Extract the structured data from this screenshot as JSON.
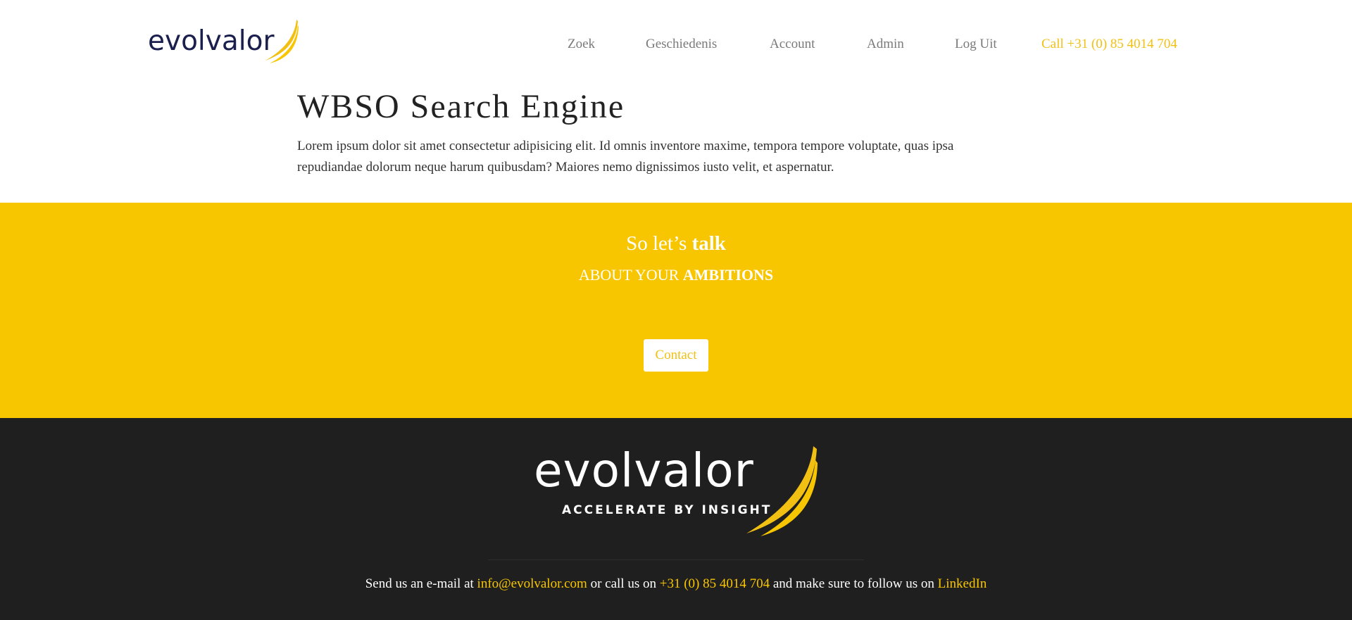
{
  "brand": {
    "logo_text": "evolvalor",
    "tagline": "ACCELERATE BY INSIGHT",
    "accent_color": "#f8c600",
    "navy_color": "#1b1f4d",
    "footer_bg": "#1f1f1f"
  },
  "nav": {
    "items": [
      {
        "label": "Zoek"
      },
      {
        "label": "Geschiedenis"
      },
      {
        "label": "Account"
      },
      {
        "label": "Admin"
      },
      {
        "label": "Log Uit"
      }
    ],
    "call": "Call +31 (0) 85 4014 704"
  },
  "intro": {
    "title": "WBSO Search Engine",
    "body": "Lorem ipsum dolor sit amet consectetur adipisicing elit. Id omnis inventore maxime, tempora tempore voluptate, quas ipsa repudiandae dolorum neque harum quibusdam? Maiores nemo dignissimos iusto velit, et aspernatur."
  },
  "cta": {
    "talk_prefix": "So let’s ",
    "talk_bold": "talk",
    "amb_prefix": "ABOUT YOUR ",
    "amb_bold": "AMBITIONS",
    "button": "Contact"
  },
  "footer": {
    "text1": "Send us an e-mail at ",
    "email": "info@evolvalor.com",
    "text2": " or call us on ",
    "phone": "+31 (0) 85 4014 704",
    "text3": " and make sure to follow us on ",
    "linkedin": "LinkedIn"
  }
}
